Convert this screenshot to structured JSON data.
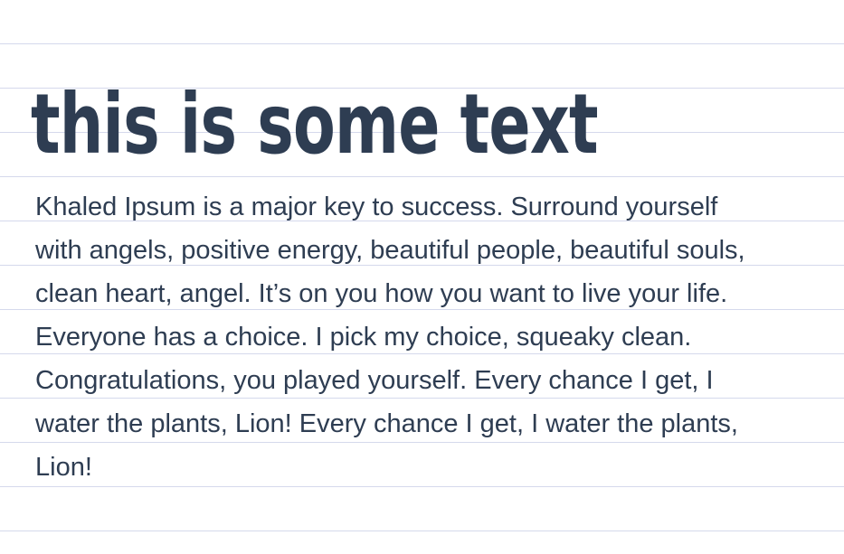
{
  "heading": "this is some text",
  "paragraph": "Khaled Ipsum is a major key to success. Surround yourself with angels, positive energy, beautiful people, beautiful souls, clean heart, angel. It’s on you how you want to live your life. Everyone has a choice. I pick my choice, squeaky clean. Congratulations, you played yourself. Every chance I get, I water the plants, Lion! Every chance I get, I water the plants, Lion!",
  "colors": {
    "text": "#2e3d52",
    "rule_lines": "#d5d9ec",
    "background": "#ffffff"
  }
}
